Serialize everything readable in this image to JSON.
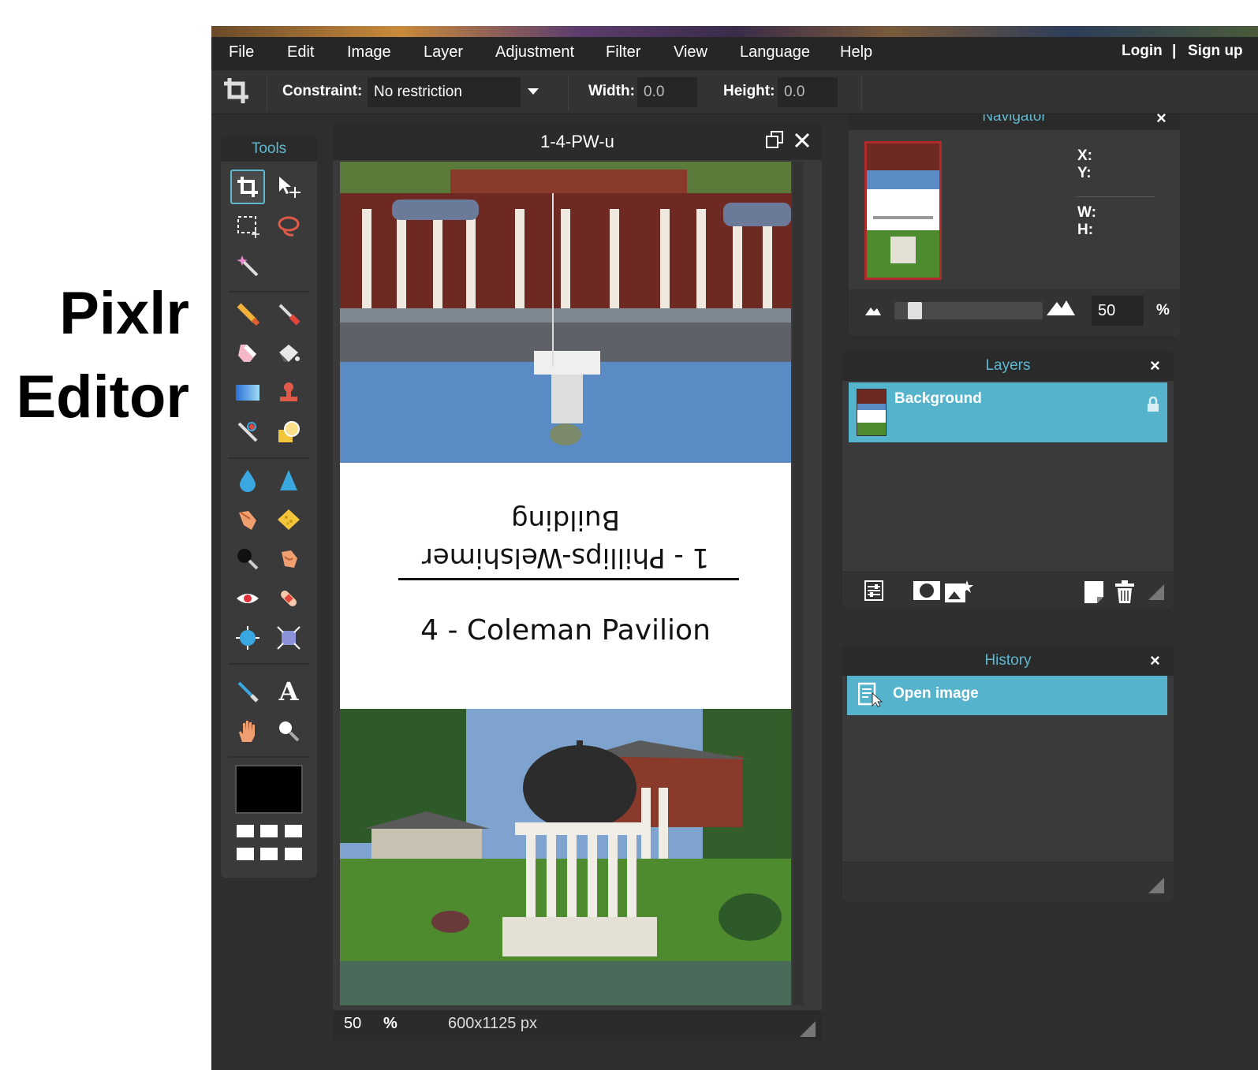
{
  "side_title": {
    "line1": "Pixlr",
    "line2": "Editor"
  },
  "menu": [
    "File",
    "Edit",
    "Image",
    "Layer",
    "Adjustment",
    "Filter",
    "View",
    "Language",
    "Help"
  ],
  "auth": {
    "login": "Login",
    "separator": "|",
    "signup": "Sign up"
  },
  "toolbar": {
    "constraint_label": "Constraint:",
    "constraint_value": "No restriction",
    "width_label": "Width:",
    "width_value": "0.0",
    "height_label": "Height:",
    "height_value": "0.0"
  },
  "tools": {
    "title": "Tools",
    "active_tool": "crop",
    "foreground_color": "#000000"
  },
  "document": {
    "title": "1-4-PW-u",
    "zoom": "50",
    "zoom_unit": "%",
    "size": "600x1125 px",
    "caption_line1": "1 - Phillips-Welshimer",
    "caption_line2": "Building",
    "caption_line3": "4 - Coleman Pavilion"
  },
  "navigator": {
    "title": "Navigator",
    "x_label": "X:",
    "y_label": "Y:",
    "w_label": "W:",
    "h_label": "H:",
    "zoom_value": "50",
    "zoom_unit": "%",
    "zoom_level": 0.1
  },
  "layers": {
    "title": "Layers",
    "items": [
      {
        "name": "Background",
        "locked": true
      }
    ]
  },
  "history": {
    "title": "History",
    "items": [
      {
        "label": "Open image"
      }
    ]
  },
  "colors": {
    "accent": "#55b4cc",
    "panel_bg": "#3a3a3a",
    "app_bg": "#2e2e2e",
    "header_text": "#5fb8cf"
  }
}
